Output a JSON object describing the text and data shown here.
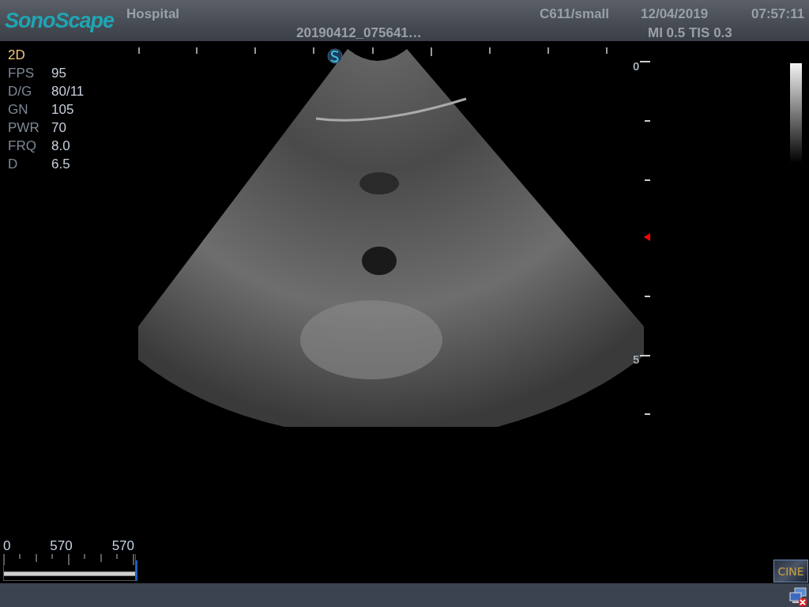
{
  "header": {
    "logo": "SonoScape",
    "hospital": "Hospital",
    "file_name": "20190412_075641…",
    "probe": "C611/small",
    "date": "12/04/2019",
    "time": "07:57:11",
    "indices": "MI 0.5 TIS 0.3"
  },
  "mode": "2D",
  "parameters": [
    {
      "label": "FPS",
      "value": "95"
    },
    {
      "label": "D/G",
      "value": "80/11"
    },
    {
      "label": "GN",
      "value": "105"
    },
    {
      "label": "PWR",
      "value": "70"
    },
    {
      "label": "FRQ",
      "value": "8.0"
    },
    {
      "label": "D",
      "value": "6.5"
    }
  ],
  "depth_scale": {
    "labels": [
      "0",
      "5"
    ]
  },
  "cine_bar": {
    "labels": [
      "0",
      "570",
      "570"
    ],
    "level": 1
  },
  "cine_button": {
    "label": "CINE"
  }
}
